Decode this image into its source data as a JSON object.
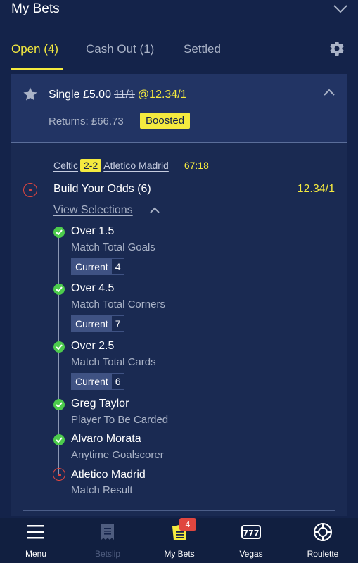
{
  "header": {
    "title": "My Bets"
  },
  "tabs": [
    {
      "label": "Open (4)"
    },
    {
      "label": "Cash Out (1)"
    },
    {
      "label": "Settled"
    }
  ],
  "bet": {
    "title": "Single £5.00",
    "old_odds": "11/1",
    "boosted_odds": "@12.34/1",
    "returns": "Returns: £66.73",
    "badge": "Boosted"
  },
  "match": {
    "home": "Celtic",
    "score": "2-2",
    "away": "Atletico Madrid",
    "clock": "67:18"
  },
  "market": {
    "name": "Build Your Odds (6)",
    "odds": "12.34/1",
    "view_label": "View Selections"
  },
  "selections": [
    {
      "name": "Over 1.5",
      "desc": "Match Total Goals",
      "current_label": "Current",
      "current_value": "4",
      "status": "won"
    },
    {
      "name": "Over 4.5",
      "desc": "Match Total Corners",
      "current_label": "Current",
      "current_value": "7",
      "status": "won"
    },
    {
      "name": "Over 2.5",
      "desc": "Match Total Cards",
      "current_label": "Current",
      "current_value": "6",
      "status": "won"
    },
    {
      "name": "Greg Taylor",
      "desc": "Player To Be Carded",
      "status": "won"
    },
    {
      "name": "Alvaro Morata",
      "desc": "Anytime Goalscorer",
      "status": "won"
    },
    {
      "name": "Atletico Madrid",
      "desc": "Match Result",
      "status": "lost"
    }
  ],
  "nav": [
    {
      "label": "Menu",
      "icon": "menu-icon"
    },
    {
      "label": "Betslip",
      "icon": "betslip-icon"
    },
    {
      "label": "My Bets",
      "icon": "my-bets-icon",
      "badge": "4"
    },
    {
      "label": "Vegas",
      "icon": "vegas-icon"
    },
    {
      "label": "Roulette",
      "icon": "roulette-icon"
    }
  ],
  "colors": {
    "background": "#14234a",
    "accent": "#f4ea3f",
    "won": "#4ccb4c",
    "lost": "#e0463f"
  }
}
